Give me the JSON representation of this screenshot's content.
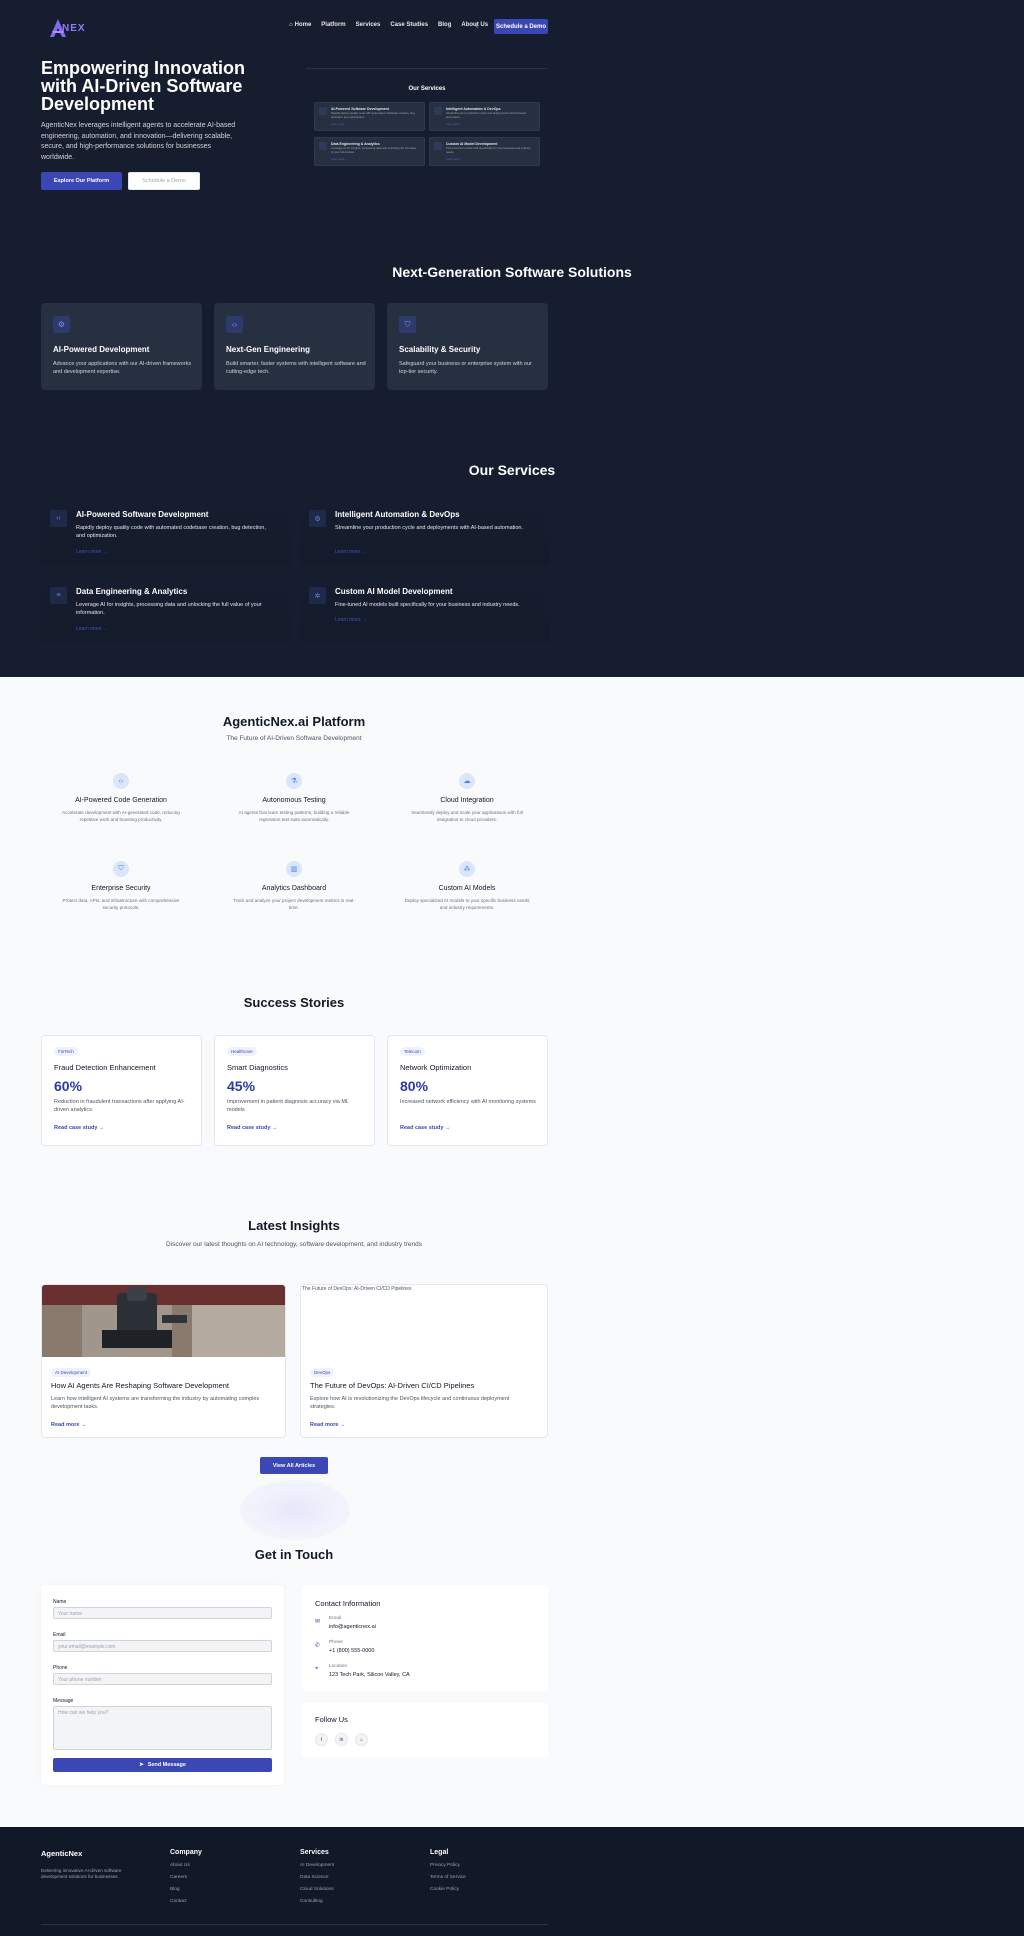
{
  "nav": {
    "logo_text": "NEX",
    "items": [
      "Home",
      "Platform",
      "Services",
      "Case Studies",
      "Blog",
      "About Us"
    ],
    "cta": "Schedule a Demo"
  },
  "hero": {
    "title": "Empowering Innovation with AI-Driven Software Development",
    "text": "AgenticNex leverages intelligent agents to accelerate AI-based engineering, automation, and innovation—delivering scalable, secure, and high-performance solutions for businesses worldwide.",
    "primary_btn": "Explore Our Platform",
    "secondary_btn": "Schedule a Demo",
    "panel_title": "Our Services",
    "panel_items": [
      {
        "title": "AI-Powered Software Development",
        "desc": "Rapidly deploy quality code with automated codebase creation, bug detection, and optimization.",
        "link": "Learn more →"
      },
      {
        "title": "Intelligent Automation & DevOps",
        "desc": "Streamline your production cycle and deployments with AI-based automation.",
        "link": "Learn more →"
      },
      {
        "title": "Data Engineering & Analytics",
        "desc": "Leverage AI for insights, processing data and unlocking the full value of your information.",
        "link": "Learn more →"
      },
      {
        "title": "Custom AI Model Development",
        "desc": "Fine-tuned AI models built specifically for your business and industry needs.",
        "link": "Learn more →"
      }
    ]
  },
  "nextgen": {
    "title": "Next-Generation Software Solutions",
    "cards": [
      {
        "icon": "gear-icon",
        "title": "AI-Powered Development",
        "desc": "Advance your applications with our AI-driven frameworks and development expertise."
      },
      {
        "icon": "code-icon",
        "title": "Next-Gen Engineering",
        "desc": "Build smarter, faster systems with intelligent software and cutting-edge tech."
      },
      {
        "icon": "shield-icon",
        "title": "Scalability & Security",
        "desc": "Safeguard your business or enterprise system with our top-tier security."
      }
    ]
  },
  "services": {
    "title": "Our Services",
    "items": [
      {
        "icon": "code-icon",
        "title": "AI-Powered Software Development",
        "desc": "Rapidly deploy quality code with automated codebase creation, bug detection, and optimization.",
        "link": "Learn more →"
      },
      {
        "icon": "automation-icon",
        "title": "Intelligent Automation & DevOps",
        "desc": "Streamline your production cycle and deployments with AI-based automation.",
        "link": "Learn more →"
      },
      {
        "icon": "database-icon",
        "title": "Data Engineering & Analytics",
        "desc": "Leverage AI for insights, processing data and unlocking the full value of your information.",
        "link": "Learn more →"
      },
      {
        "icon": "cpu-icon",
        "title": "Custom AI Model Development",
        "desc": "Fine-tuned AI models built specifically for your business and industry needs.",
        "link": "Learn more →"
      }
    ]
  },
  "platform": {
    "title": "AgenticNex.ai Platform",
    "subtitle": "The Future of AI-Driven Software Development",
    "items": [
      {
        "icon": "code-icon",
        "title": "AI-Powered Code Generation",
        "desc": "Accelerate development with AI-generated code, reducing repetitive work and boosting productivity."
      },
      {
        "icon": "flask-icon",
        "title": "Autonomous Testing",
        "desc": "AI agents that learn testing patterns, building a reliable regression test suite automatically."
      },
      {
        "icon": "cloud-icon",
        "title": "Cloud Integration",
        "desc": "Seamlessly deploy and scale your applications with full integration to cloud providers."
      },
      {
        "icon": "shield-icon",
        "title": "Enterprise Security",
        "desc": "Protect data, APIs, and infrastructure with comprehensive security protocols."
      },
      {
        "icon": "bar-chart-icon",
        "title": "Analytics Dashboard",
        "desc": "Track and analyze your project development metrics in real-time."
      },
      {
        "icon": "network-icon",
        "title": "Custom AI Models",
        "desc": "Deploy specialized AI models to your specific business needs and industry requirements."
      }
    ]
  },
  "success": {
    "title": "Success Stories",
    "cards": [
      {
        "tag": "FinTech",
        "title": "Fraud Detection Enhancement",
        "value": "60%",
        "desc": "Reduction in fraudulent transactions after applying AI-driven analytics.",
        "link": "Read case study →"
      },
      {
        "tag": "Healthcare",
        "title": "Smart Diagnostics",
        "value": "45%",
        "desc": "Improvement in patient diagnosis accuracy via ML models",
        "link": "Read case study →"
      },
      {
        "tag": "Telecom",
        "title": "Network Optimization",
        "value": "80%",
        "desc": "Increased network efficiency with AI monitoring systems",
        "link": "Read case study →"
      }
    ]
  },
  "insights": {
    "title": "Latest Insights",
    "subtitle": "Discover our latest thoughts on AI technology, software development, and industry trends",
    "cards": [
      {
        "tag": "AI Development",
        "title": "How AI Agents Are Reshaping Software Development",
        "desc": "Learn how intelligent AI systems are transforming the industry by automating complex development tasks.",
        "link": "Read more →"
      },
      {
        "tag": "DevOps",
        "title": "The Future of DevOps: AI-Driven CI/CD Pipelines",
        "desc": "Explore how AI is revolutionizing the DevOps lifecycle and continuous deployment strategies.",
        "link": "Read more →",
        "broken_img_alt": "The Future of DevOps: AI-Driven CI/CD Pipelines"
      }
    ],
    "view_all": "View All Articles"
  },
  "contact": {
    "title": "Get in Touch",
    "form": {
      "name_label": "Name",
      "name_placeholder": "Your name",
      "email_label": "Email",
      "email_placeholder": "your.email@example.com",
      "phone_label": "Phone",
      "phone_placeholder": "Your phone number",
      "message_label": "Message",
      "message_placeholder": "How can we help you?",
      "send": "Send Message"
    },
    "info": {
      "title": "Contact Information",
      "email_label": "Email",
      "email": "info@agenticnex.ai",
      "phone_label": "Phone",
      "phone": "+1 (800) 555-0000",
      "location_label": "Location",
      "location": "123 Tech Park, Silicon Valley, CA"
    },
    "follow": {
      "title": "Follow Us",
      "icons": [
        "twitter-icon",
        "linkedin-icon",
        "github-icon"
      ]
    }
  },
  "footer": {
    "brand": "AgenticNex",
    "desc": "Delivering innovative AI-driven software development solutions for businesses.",
    "columns": [
      {
        "title": "Company",
        "items": [
          "About Us",
          "Careers",
          "Blog",
          "Contact"
        ]
      },
      {
        "title": "Services",
        "items": [
          "AI Development",
          "Data Science",
          "Cloud Solutions",
          "Consulting"
        ]
      },
      {
        "title": "Legal",
        "items": [
          "Privacy Policy",
          "Terms of Service",
          "Cookie Policy"
        ]
      }
    ]
  },
  "colors": {
    "dark_bg": "#161d2f",
    "accent": "#3b47b4",
    "card_dark": "#263041",
    "light_bg": "#f8fafc"
  }
}
